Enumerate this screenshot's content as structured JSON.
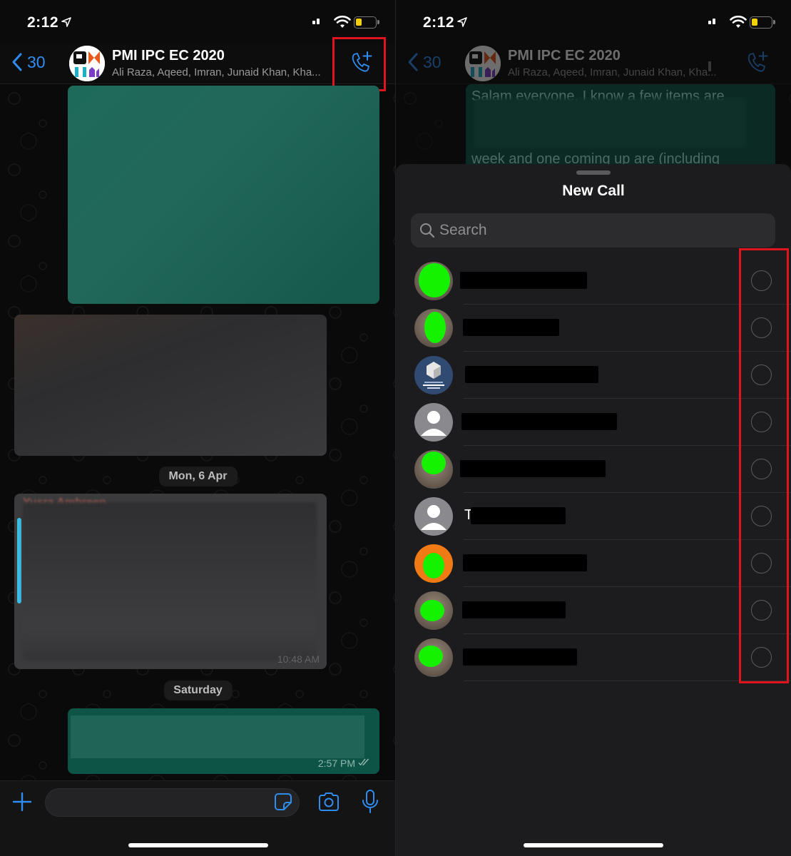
{
  "status_bar": {
    "time": "2:12"
  },
  "chat": {
    "back_count": "30",
    "group_name": "PMI IPC EC 2020",
    "participants": "Ali Raza, Aqeed, Imran, Junaid Khan, Kha...",
    "date_separators": [
      "Mon, 6 Apr",
      "Saturday"
    ],
    "messages": [
      {
        "direction": "outgoing",
        "content": "[redacted]"
      },
      {
        "direction": "incoming",
        "content": "[redacted]"
      },
      {
        "direction": "incoming",
        "sender": "Yusra Ambreen",
        "content": "[redacted]",
        "time": "10:48 AM"
      },
      {
        "direction": "outgoing",
        "content": "[redacted]",
        "time": "2:57 PM",
        "status": "read"
      }
    ],
    "composer": {
      "placeholder": "",
      "value": ""
    },
    "icons": {
      "back": "chevron-left-icon",
      "call": "phone-plus-icon",
      "attach": "plus-icon",
      "sticker": "sticker-icon",
      "camera": "camera-icon",
      "mic": "microphone-icon"
    }
  },
  "background_preview": {
    "visible_lines": [
      "Salam everyone, I know a few items are",
      "week and one coming up are (including"
    ]
  },
  "new_call_sheet": {
    "title": "New Call",
    "search_placeholder": "Search",
    "contacts": [
      {
        "name": "[redacted]",
        "selected": false,
        "avatar": "photo"
      },
      {
        "name": "[redacted]",
        "selected": false,
        "avatar": "photo"
      },
      {
        "name": "[redacted]",
        "selected": false,
        "avatar": "autodesk-ambassador-badge"
      },
      {
        "name": "[redacted]",
        "selected": false,
        "avatar": "default"
      },
      {
        "name": "[redacted]",
        "selected": false,
        "avatar": "photo"
      },
      {
        "name": "T[redacted]",
        "name_prefix": "T",
        "selected": false,
        "avatar": "default"
      },
      {
        "name": "[redacted]",
        "selected": false,
        "avatar": "photo-orange"
      },
      {
        "name": "[redacted]",
        "selected": false,
        "avatar": "photo"
      },
      {
        "name": "[redacted]",
        "selected": false,
        "avatar": "photo"
      }
    ]
  },
  "colors": {
    "accent": "#2f8cf0",
    "outgoing_bubble": "#1e6a5a",
    "incoming_bubble": "#2d2d2f",
    "highlight": "#e0141c",
    "sheet_bg": "#1c1c1e"
  }
}
